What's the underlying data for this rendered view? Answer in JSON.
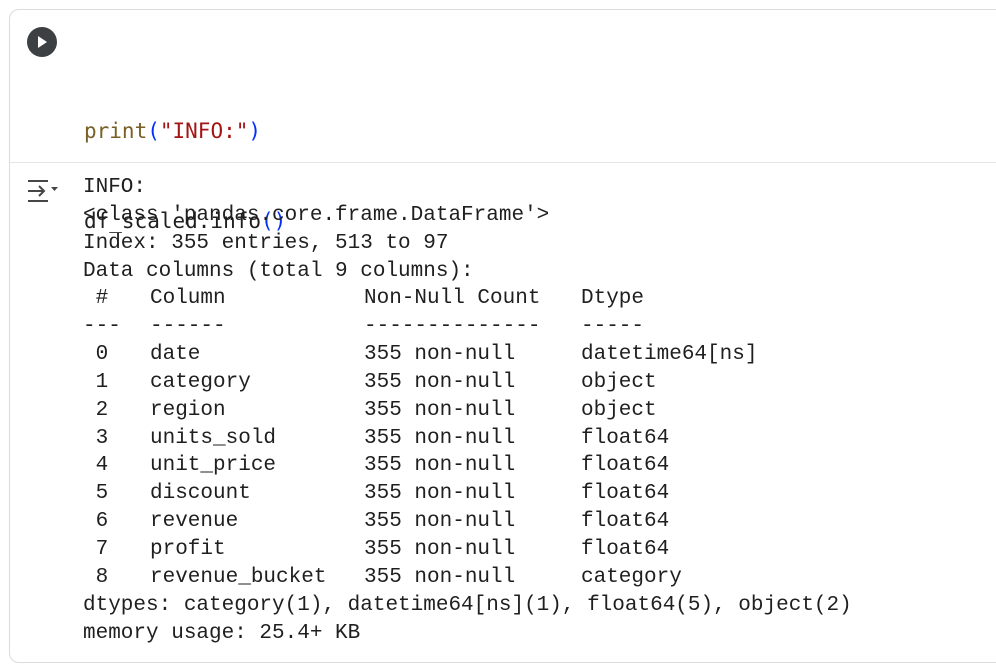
{
  "cell": {
    "code": {
      "line1": {
        "fn": "print",
        "open": "(",
        "str": "\"INFO:\"",
        "close": ")"
      },
      "line2": {
        "obj": "df_scaled.info",
        "parens": "()"
      }
    }
  },
  "output": {
    "label": "INFO:",
    "class_line": "<class 'pandas.core.frame.DataFrame'>",
    "index_line": "Index: 355 entries, 513 to 97",
    "columns_line": "Data columns (total 9 columns):",
    "header": {
      "idx": " # ",
      "name": "Column",
      "count": "Non-Null Count",
      "dtype": "Dtype"
    },
    "separator": {
      "idx": "---",
      "name": "------",
      "count": "--------------",
      "dtype": "-----"
    },
    "rows": [
      {
        "idx": " 0 ",
        "name": "date",
        "count": "355 non-null",
        "dtype": "datetime64[ns]"
      },
      {
        "idx": " 1 ",
        "name": "category",
        "count": "355 non-null",
        "dtype": "object"
      },
      {
        "idx": " 2 ",
        "name": "region",
        "count": "355 non-null",
        "dtype": "object"
      },
      {
        "idx": " 3 ",
        "name": "units_sold",
        "count": "355 non-null",
        "dtype": "float64"
      },
      {
        "idx": " 4 ",
        "name": "unit_price",
        "count": "355 non-null",
        "dtype": "float64"
      },
      {
        "idx": " 5 ",
        "name": "discount",
        "count": "355 non-null",
        "dtype": "float64"
      },
      {
        "idx": " 6 ",
        "name": "revenue",
        "count": "355 non-null",
        "dtype": "float64"
      },
      {
        "idx": " 7 ",
        "name": "profit",
        "count": "355 non-null",
        "dtype": "float64"
      },
      {
        "idx": " 8 ",
        "name": "revenue_bucket",
        "count": "355 non-null",
        "dtype": "category"
      }
    ],
    "dtypes_line": "dtypes: category(1), datetime64[ns](1), float64(5), object(2)",
    "memory_line": "memory usage: 25.4+ KB"
  },
  "icons": {
    "run": "play-icon",
    "output_toggle": "output-toggle-icon"
  },
  "colors": {
    "run_button": "#3c4043",
    "fn": "#795e26",
    "string": "#a31515",
    "paren": "#0431fa"
  }
}
